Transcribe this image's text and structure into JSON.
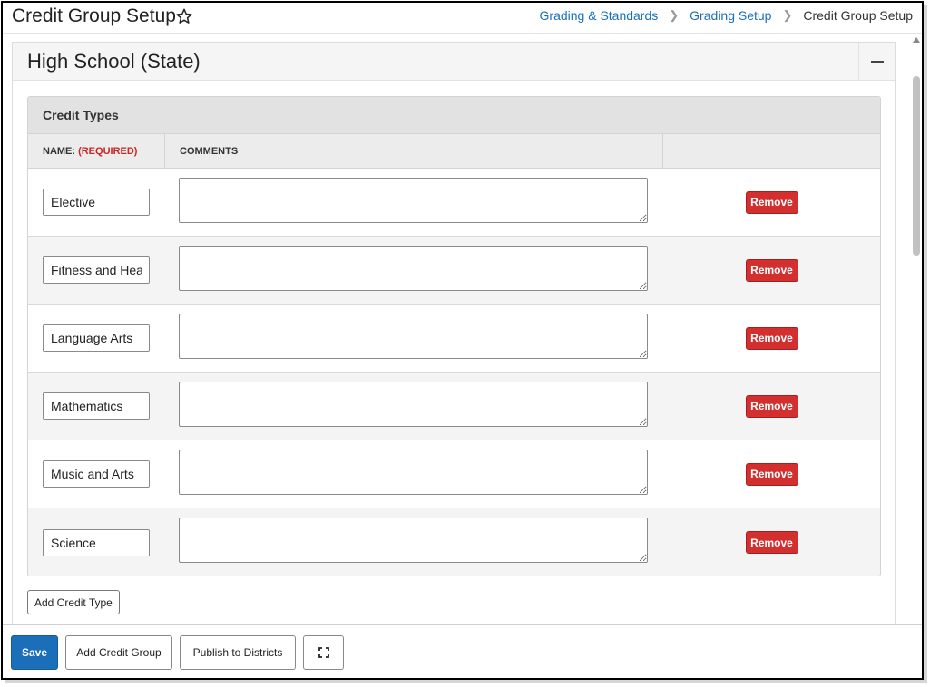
{
  "header": {
    "title": "Credit Group Setup",
    "breadcrumbs": [
      "Grading & Standards",
      "Grading Setup",
      "Credit Group Setup"
    ]
  },
  "panel": {
    "title": "High School (State)"
  },
  "credit_types": {
    "heading": "Credit Types",
    "col_name": "NAME:",
    "col_name_required": "(REQUIRED)",
    "col_comments": "COMMENTS",
    "rows": [
      {
        "name": "Elective",
        "comment": ""
      },
      {
        "name": "Fitness and Hea",
        "comment": ""
      },
      {
        "name": "Language Arts",
        "comment": ""
      },
      {
        "name": "Mathematics",
        "comment": ""
      },
      {
        "name": "Music and Arts",
        "comment": ""
      },
      {
        "name": "Science",
        "comment": ""
      }
    ],
    "remove_label": "Remove",
    "add_label": "Add Credit Type"
  },
  "footer": {
    "save_label": "Save",
    "add_group_label": "Add Credit Group",
    "publish_label": "Publish to Districts"
  },
  "colors": {
    "primary": "#1a6fb8",
    "danger": "#d32f2f",
    "required": "#c62828"
  }
}
